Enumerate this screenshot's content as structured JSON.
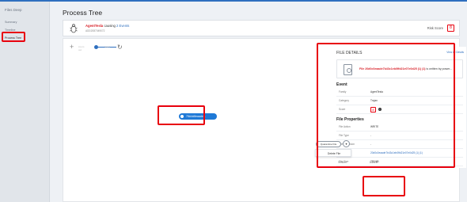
{
  "sidebar": {
    "title": "Files Deep",
    "items": [
      {
        "label": "Summary",
        "active": false
      },
      {
        "label": "Timeline",
        "active": false
      },
      {
        "label": "Process Tree",
        "active": true
      }
    ]
  },
  "page": {
    "title": "Process Tree"
  },
  "header": {
    "threat_name": "AgentTesla",
    "causing_text": "causing",
    "events_count_text": "2 Events",
    "id_text": "ADD2087049072",
    "risk_label": "Risk Score",
    "risk_value": "8"
  },
  "toolbar": {
    "zoom_out_label": "zoom out",
    "reset_label": "reset",
    "zoom_level": 0.5
  },
  "tree": {
    "node_label": "75A4d8eaade..."
  },
  "file_details": {
    "heading": "FILE DETAILS",
    "view_all": "View All Details",
    "file_name_short": "File 20d0c0eaade7b43c1eb0ffd21e07e0d25 (1) (1)",
    "file_msg_rest": "is written by power...",
    "event": {
      "title": "Event",
      "rows": [
        {
          "label": "Family",
          "value": "AgentTesla"
        },
        {
          "label": "Category",
          "value": "Trojan"
        },
        {
          "label": "Score",
          "value": "8"
        }
      ]
    },
    "properties": {
      "title": "File Properties",
      "rows": [
        {
          "label": "File Action",
          "value": "WRITE"
        },
        {
          "label": "File Type",
          "value": "-"
        },
        {
          "label": "File Extension",
          "value": "-"
        },
        {
          "label": "File Name",
          "value": "20d0c0eaade7b43c1eb0ffd21e07e0d25 (1) (1)"
        },
        {
          "label": "File Size",
          "value": "797 KB"
        },
        {
          "label": "Version",
          "value": "1.0.0.0"
        }
      ]
    }
  },
  "actions": {
    "quarantine_label": "Quarantine File",
    "dropdown_caret": "▾",
    "dropdown_items": [
      {
        "label": "Delete File"
      }
    ]
  },
  "colors": {
    "accent": "#2f6fbf",
    "danger": "#d8222a",
    "highlight_box": "#e8000d",
    "node_fill": "#1f79d6"
  }
}
